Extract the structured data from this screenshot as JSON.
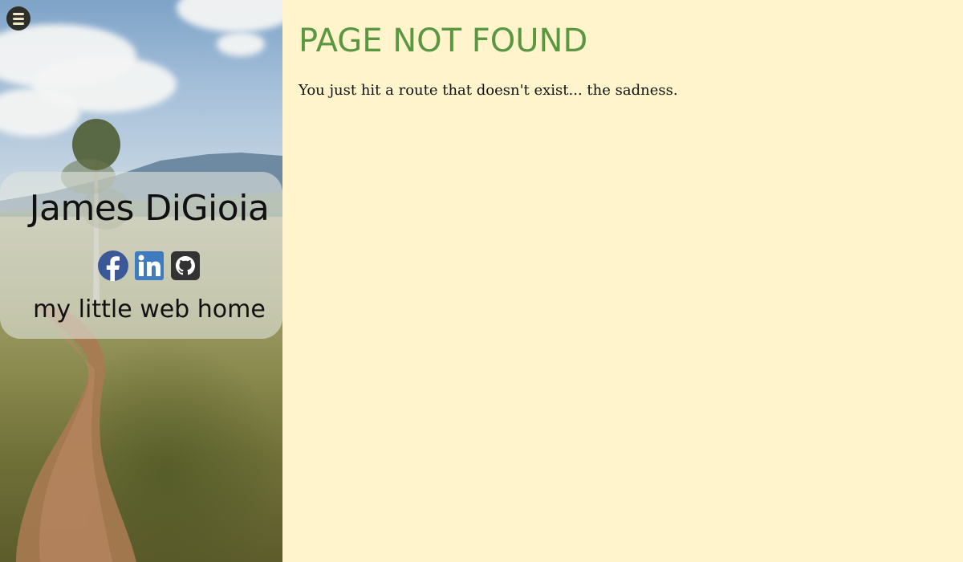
{
  "sidebar": {
    "name": "James DiGioia",
    "tagline": "my little web home",
    "social_icons": [
      "facebook-icon",
      "linkedin-icon",
      "github-icon"
    ],
    "colors": {
      "facebook": "#3b5998",
      "linkedin": "#3f7bbf",
      "github": "#333333"
    }
  },
  "menu": {
    "icon": "hamburger-icon"
  },
  "main": {
    "title": "PAGE NOT FOUND",
    "message": "You just hit a route that doesn't exist... the sadness.",
    "title_color": "#5b9741",
    "background": "#fff4cc"
  }
}
